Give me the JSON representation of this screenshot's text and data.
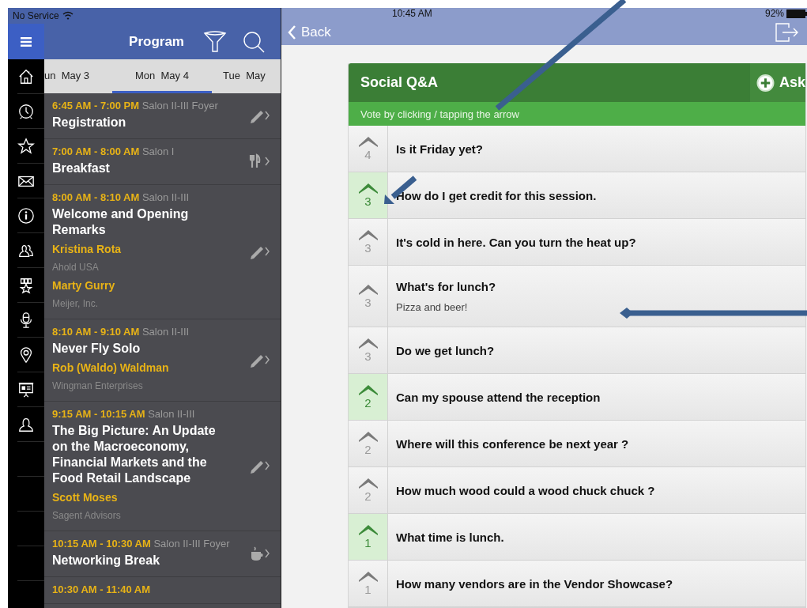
{
  "status_bar": {
    "carrier": "No Service",
    "time": "10:45 AM",
    "battery": "92%"
  },
  "program": {
    "title": "Program",
    "days": [
      {
        "label": "un  May 3",
        "selected": false
      },
      {
        "label": "Mon  May 4",
        "selected": true
      },
      {
        "label": "Tue  May",
        "selected": false
      }
    ],
    "sessions": [
      {
        "time": "6:45 AM - 7:00 PM",
        "location": "Salon II-III Foyer",
        "title": "Registration",
        "kind": "pencil"
      },
      {
        "time": "7:00 AM - 8:00 AM",
        "location": "Salon I",
        "title": "Breakfast",
        "kind": "meal"
      },
      {
        "time": "8:00 AM - 8:10 AM",
        "location": "Salon II-III",
        "title": "Welcome and Opening Remarks",
        "speakers": [
          {
            "name": "Kristina Rota",
            "org": "Ahold USA"
          },
          {
            "name": "Marty Gurry",
            "org": "Meijer, Inc."
          }
        ],
        "kind": "pencil"
      },
      {
        "time": "8:10 AM - 9:10 AM",
        "location": "Salon II-III",
        "title": "Never Fly Solo",
        "speakers": [
          {
            "name": "Rob (Waldo) Waldman",
            "org": "Wingman Enterprises"
          }
        ],
        "kind": "pencil"
      },
      {
        "time": "9:15 AM - 10:15 AM",
        "location": "Salon II-III",
        "title": "The Big Picture: An Update on the Macroeconomy, Financial Markets and the Food Retail Landscape",
        "speakers": [
          {
            "name": "Scott Moses",
            "org": "Sagent Advisors"
          }
        ],
        "kind": "pencil"
      },
      {
        "time": "10:15 AM - 10:30 AM",
        "location": "Salon II-III Foyer",
        "title": "Networking Break",
        "kind": "coffee"
      },
      {
        "time": "10:30 AM - 11:40 AM",
        "kind": "none"
      }
    ]
  },
  "qa": {
    "back": "Back",
    "title": "Social Q&A",
    "ask": "Ask",
    "hint": "Vote by clicking / tapping the arrow",
    "questions": [
      {
        "text": "Is it Friday yet?",
        "votes": "4",
        "voted": false
      },
      {
        "text": "How do I get credit for this session.",
        "votes": "3",
        "voted": true
      },
      {
        "text": "It's cold in here. Can you turn the heat up?",
        "votes": "3",
        "voted": false
      },
      {
        "text": "What's for lunch?",
        "answer": "Pizza and beer!",
        "votes": "3",
        "voted": false
      },
      {
        "text": "Do we get lunch?",
        "votes": "3",
        "voted": false
      },
      {
        "text": "Can my spouse attend the reception",
        "votes": "2",
        "voted": true
      },
      {
        "text": "Where will this conference be next year ?",
        "votes": "2",
        "voted": false
      },
      {
        "text": "How much wood could a wood chuck chuck ?",
        "votes": "2",
        "voted": false
      },
      {
        "text": "What time is lunch.",
        "votes": "1",
        "voted": true
      },
      {
        "text": "How many vendors are in the Vendor Showcase?",
        "votes": "1",
        "voted": false
      }
    ]
  }
}
